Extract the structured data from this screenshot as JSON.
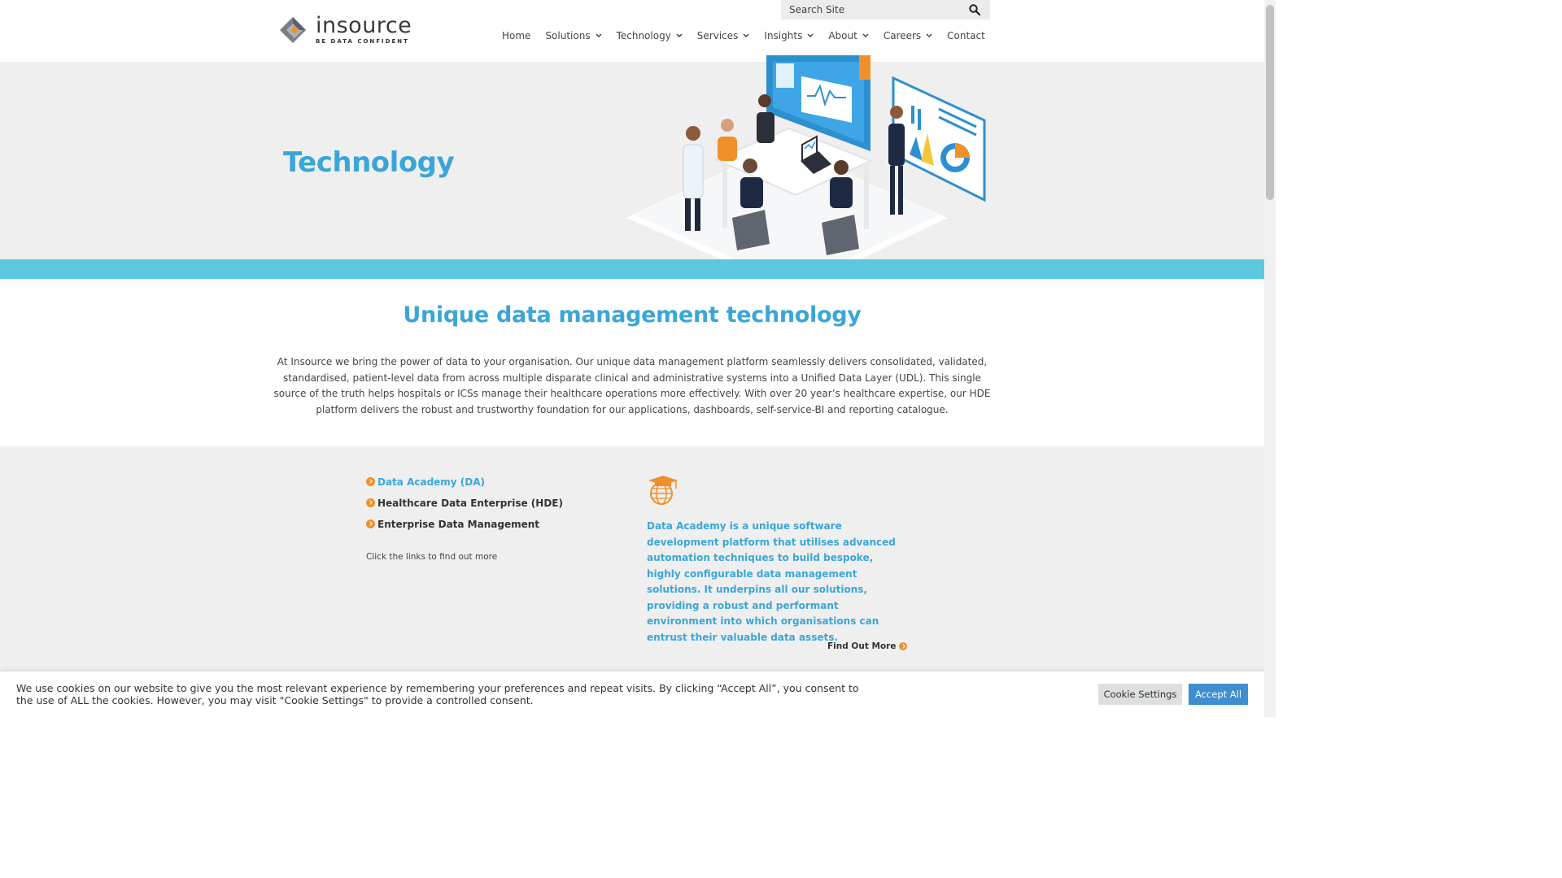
{
  "brand": {
    "name": "insource",
    "tagline": "BE DATA CONFIDENT"
  },
  "search": {
    "placeholder": "Search Site",
    "icon": "search-icon"
  },
  "nav": [
    {
      "label": "Home",
      "dropdown": false
    },
    {
      "label": "Solutions",
      "dropdown": true
    },
    {
      "label": "Technology",
      "dropdown": true
    },
    {
      "label": "Services",
      "dropdown": true
    },
    {
      "label": "Insights",
      "dropdown": true
    },
    {
      "label": "About",
      "dropdown": true
    },
    {
      "label": "Careers",
      "dropdown": true
    },
    {
      "label": "Contact",
      "dropdown": false
    }
  ],
  "hero": {
    "title": "Technology"
  },
  "intro": {
    "title": "Unique data management technology",
    "text": "At Insource we bring the power of data to your organisation. Our unique data management platform seamlessly delivers consolidated, validated, standardised, patient-level data from across multiple disparate clinical and administrative systems into a Unified Data Layer (UDL). This single source of the truth helps hospitals or ICSs manage their healthcare operations more effectively. With over 20 year’s healthcare expertise, our HDE platform delivers the robust and trustworthy foundation for our applications, dashboards, self-service-BI and reporting catalogue."
  },
  "tech": {
    "links": [
      {
        "label": "Data Academy (DA)",
        "active": true
      },
      {
        "label": "Healthcare Data Enterprise (HDE)",
        "active": false
      },
      {
        "label": "Enterprise Data Management",
        "active": false
      }
    ],
    "hint": "Click the links to find out more",
    "icon": "graduation-globe-icon",
    "description": "Data Academy is a unique software development platform that utilises advanced automation techniques to build bespoke, highly configurable data management solutions. It underpins all our solutions, providing a robust and performant environment into which organisations can entrust their valuable data assets.",
    "find_more": "Find Out More"
  },
  "cookie": {
    "text": "We use cookies on our website to give you the most relevant experience by remembering your preferences and repeat visits. By clicking “Accept All”, you consent to the use of ALL the cookies. However, you may visit \"Cookie Settings\" to provide a controlled consent.",
    "settings_label": "Cookie Settings",
    "accept_label": "Accept All"
  },
  "colors": {
    "accent_blue": "#3aa6d8",
    "band_teal": "#5bc8de",
    "orange": "#f0902a",
    "accept_button": "#3e8ed0"
  }
}
